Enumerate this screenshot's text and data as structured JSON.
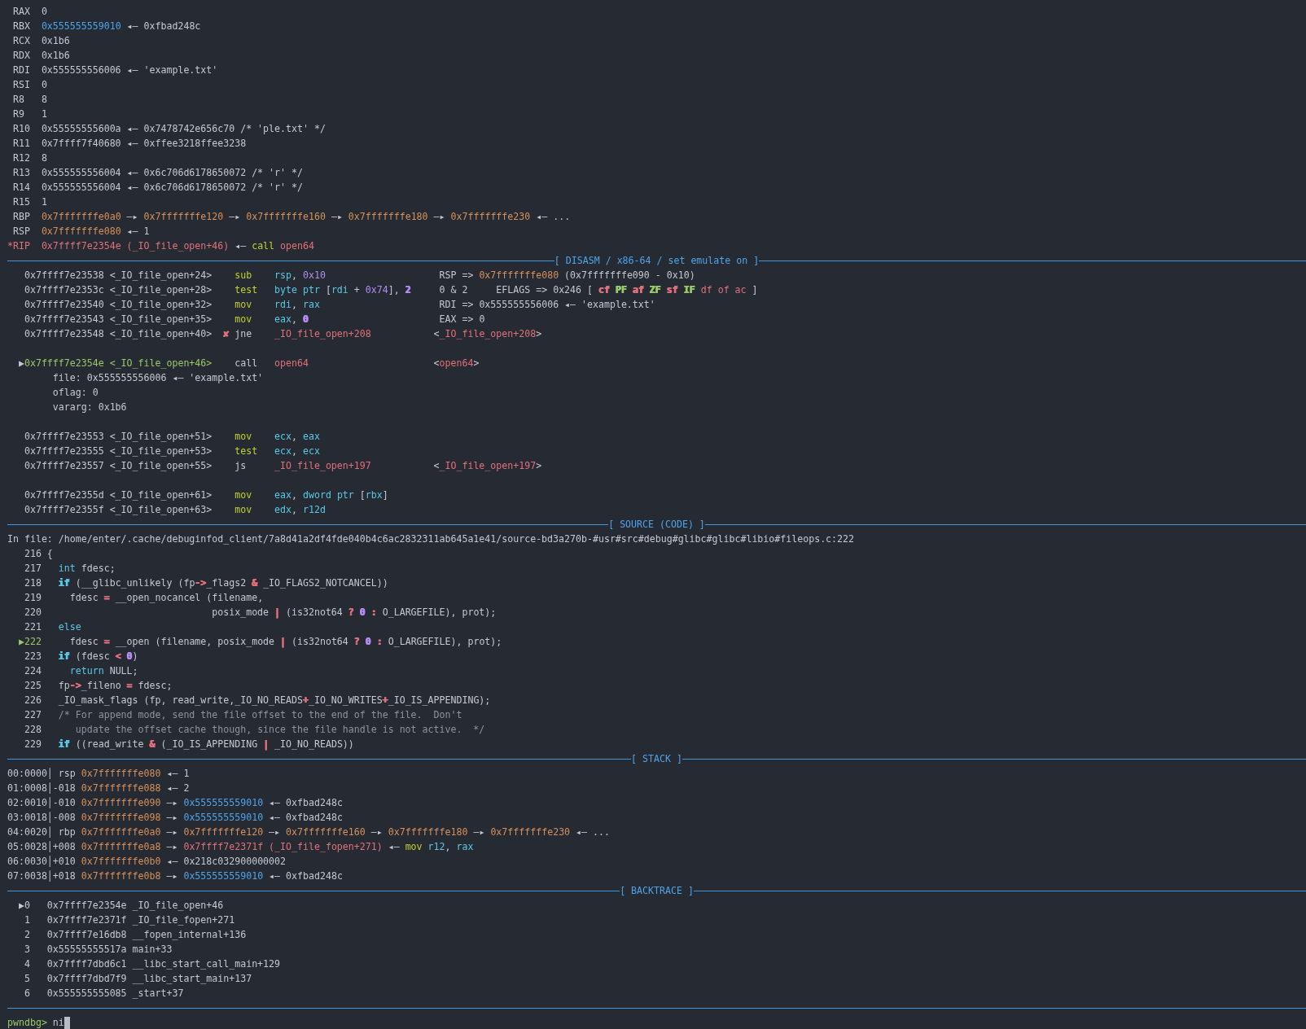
{
  "panels": [
    {
      "kind": "registers",
      "lines": [
        {
          "kind": "text",
          "spans": [
            {
              "t": " RAX  0"
            }
          ]
        },
        {
          "kind": "text",
          "spans": [
            {
              "t": " RBX  "
            },
            {
              "t": "0x555555559010",
              "color": "#4ea4ea"
            },
            {
              "t": " ◂— 0xfbad248c"
            }
          ]
        },
        {
          "kind": "text",
          "spans": [
            {
              "t": " RCX  0x1b6"
            }
          ]
        },
        {
          "kind": "text",
          "spans": [
            {
              "t": " RDX  0x1b6"
            }
          ]
        },
        {
          "kind": "text",
          "spans": [
            {
              "t": " RDI  0x555555556006 ◂— 'example.txt'"
            }
          ]
        },
        {
          "kind": "text",
          "spans": [
            {
              "t": " RSI  0"
            }
          ]
        },
        {
          "kind": "text",
          "spans": [
            {
              "t": " R8   8"
            }
          ]
        },
        {
          "kind": "text",
          "spans": [
            {
              "t": " R9   1"
            }
          ]
        },
        {
          "kind": "text",
          "spans": [
            {
              "t": " R10  0x55555555600a ◂— 0x7478742e656c70 /* 'ple.txt' */"
            }
          ]
        },
        {
          "kind": "text",
          "spans": [
            {
              "t": " R11  0x7ffff7f40680 ◂— 0xffee3218ffee3238"
            }
          ]
        },
        {
          "kind": "text",
          "spans": [
            {
              "t": " R12  8"
            }
          ]
        },
        {
          "kind": "text",
          "spans": [
            {
              "t": " R13  0x555555556004 ◂— 0x6c706d6178650072 /* 'r' */"
            }
          ]
        },
        {
          "kind": "text",
          "spans": [
            {
              "t": " R14  0x555555556004 ◂— 0x6c706d6178650072 /* 'r' */"
            }
          ]
        },
        {
          "kind": "text",
          "spans": [
            {
              "t": " R15  1"
            }
          ]
        },
        {
          "kind": "text",
          "spans": [
            {
              "t": " RBP  "
            },
            {
              "t": "0x7fffffffe0a0",
              "color": "#d6915a"
            },
            {
              "t": " —▸ "
            },
            {
              "t": "0x7fffffffe120",
              "color": "#d6915a"
            },
            {
              "t": " —▸ "
            },
            {
              "t": "0x7fffffffe160",
              "color": "#d6915a"
            },
            {
              "t": " —▸ "
            },
            {
              "t": "0x7fffffffe180",
              "color": "#d6915a"
            },
            {
              "t": " —▸ "
            },
            {
              "t": "0x7fffffffe230",
              "color": "#d6915a"
            },
            {
              "t": " ◂— ..."
            }
          ]
        },
        {
          "kind": "text",
          "spans": [
            {
              "t": " RSP  "
            },
            {
              "t": "0x7fffffffe080",
              "color": "#d6915a"
            },
            {
              "t": " ◂— 1"
            }
          ]
        },
        {
          "kind": "text",
          "spans": [
            {
              "t": "*RIP  ",
              "color": "#e0707a"
            },
            {
              "t": "0x7ffff7e2354e (_IO_file_open+46)",
              "color": "#e0707a"
            },
            {
              "t": " ◂— "
            },
            {
              "t": "call ",
              "color": "#bfd02c"
            },
            {
              "t": "open64",
              "color": "#e0707a"
            }
          ]
        }
      ]
    },
    {
      "kind": "disasm",
      "title": "[ DISASM / x86-64 / set emulate on ]",
      "lines": [
        {
          "kind": "text",
          "spans": [
            {
              "t": "   0x7ffff7e23538 <_IO_file_open+24>    "
            },
            {
              "t": "sub    ",
              "color": "#bfd02c"
            },
            {
              "t": "rsp",
              "color": "#59c8e6"
            },
            {
              "t": ", "
            },
            {
              "t": "0x10",
              "color": "#b38cf2"
            },
            {
              "t": "                    RSP => "
            },
            {
              "t": "0x7fffffffe080",
              "color": "#d6915a"
            },
            {
              "t": " (0x7fffffffe090 - 0x10)"
            }
          ]
        },
        {
          "kind": "text",
          "spans": [
            {
              "t": "   0x7ffff7e2353c <_IO_file_open+28>    "
            },
            {
              "t": "test   ",
              "color": "#bfd02c"
            },
            {
              "t": "byte ptr",
              "color": "#59c8e6"
            },
            {
              "t": " ["
            },
            {
              "t": "rdi",
              "color": "#59c8e6"
            },
            {
              "t": " + "
            },
            {
              "t": "0x74",
              "color": "#b38cf2"
            },
            {
              "t": "], "
            },
            {
              "t": "2",
              "color": "#b38cf2"
            },
            {
              "t": "     0 & 2     EFLAGS => 0x246 [ "
            },
            {
              "t": "cf ",
              "color": "#e0707a"
            },
            {
              "t": "PF ",
              "color": "#98c868"
            },
            {
              "t": "af ",
              "color": "#e0707a"
            },
            {
              "t": "ZF ",
              "color": "#98c868"
            },
            {
              "t": "sf ",
              "color": "#e0707a"
            },
            {
              "t": "IF ",
              "color": "#98c868"
            },
            {
              "t": "df of ac",
              "color": "#e0707a"
            },
            {
              "t": " ]"
            }
          ]
        },
        {
          "kind": "text",
          "spans": [
            {
              "t": "   0x7ffff7e23540 <_IO_file_open+32>    "
            },
            {
              "t": "mov    ",
              "color": "#bfd02c"
            },
            {
              "t": "rdi",
              "color": "#59c8e6"
            },
            {
              "t": ", "
            },
            {
              "t": "rax",
              "color": "#59c8e6"
            },
            {
              "t": "                     RDI => 0x555555556006 ◂— 'example.txt'"
            }
          ]
        },
        {
          "kind": "text",
          "spans": [
            {
              "t": "   0x7ffff7e23543 <_IO_file_open+35>    "
            },
            {
              "t": "mov    ",
              "color": "#bfd02c"
            },
            {
              "t": "eax",
              "color": "#59c8e6"
            },
            {
              "t": ", "
            },
            {
              "t": "0",
              "color": "#b38cf2"
            },
            {
              "t": "                       EAX => 0"
            }
          ]
        },
        {
          "kind": "text",
          "spans": [
            {
              "t": "   0x7ffff7e23548 <_IO_file_open+40>  "
            },
            {
              "t": "✘",
              "color": "#e0707a"
            },
            {
              "t": " jne    "
            },
            {
              "t": "_IO_file_open+208",
              "color": "#e0707a"
            },
            {
              "t": "           <"
            },
            {
              "t": "_IO_file_open+208",
              "color": "#e0707a"
            },
            {
              "t": ">"
            }
          ]
        },
        {
          "kind": "blank"
        },
        {
          "kind": "text",
          "spans": [
            {
              "t": "  ▶"
            },
            {
              "t": "0x7ffff7e2354e <_IO_file_open+46>",
              "color": "#98c868"
            },
            {
              "t": "    call   "
            },
            {
              "t": "open64",
              "color": "#e0707a"
            },
            {
              "t": "                      <"
            },
            {
              "t": "open64",
              "color": "#e0707a"
            },
            {
              "t": ">"
            }
          ]
        },
        {
          "kind": "text",
          "spans": [
            {
              "t": "        file: 0x555555556006 ◂— 'example.txt'"
            }
          ]
        },
        {
          "kind": "text",
          "spans": [
            {
              "t": "        oflag: 0"
            }
          ]
        },
        {
          "kind": "text",
          "spans": [
            {
              "t": "        vararg: 0x1b6"
            }
          ]
        },
        {
          "kind": "blank"
        },
        {
          "kind": "text",
          "spans": [
            {
              "t": "   0x7ffff7e23553 <_IO_file_open+51>    "
            },
            {
              "t": "mov    ",
              "color": "#bfd02c"
            },
            {
              "t": "ecx",
              "color": "#59c8e6"
            },
            {
              "t": ", "
            },
            {
              "t": "eax",
              "color": "#59c8e6"
            }
          ]
        },
        {
          "kind": "text",
          "spans": [
            {
              "t": "   0x7ffff7e23555 <_IO_file_open+53>    "
            },
            {
              "t": "test   ",
              "color": "#bfd02c"
            },
            {
              "t": "ecx",
              "color": "#59c8e6"
            },
            {
              "t": ", "
            },
            {
              "t": "ecx",
              "color": "#59c8e6"
            }
          ]
        },
        {
          "kind": "text",
          "spans": [
            {
              "t": "   0x7ffff7e23557 <_IO_file_open+55>    js     "
            },
            {
              "t": "_IO_file_open+197",
              "color": "#e0707a"
            },
            {
              "t": "           <"
            },
            {
              "t": "_IO_file_open+197",
              "color": "#e0707a"
            },
            {
              "t": ">"
            }
          ]
        },
        {
          "kind": "blank"
        },
        {
          "kind": "text",
          "spans": [
            {
              "t": "   0x7ffff7e2355d <_IO_file_open+61>    "
            },
            {
              "t": "mov    ",
              "color": "#bfd02c"
            },
            {
              "t": "eax",
              "color": "#59c8e6"
            },
            {
              "t": ", "
            },
            {
              "t": "dword ptr",
              "color": "#59c8e6"
            },
            {
              "t": " ["
            },
            {
              "t": "rbx",
              "color": "#59c8e6"
            },
            {
              "t": "]"
            }
          ]
        },
        {
          "kind": "text",
          "spans": [
            {
              "t": "   0x7ffff7e2355f <_IO_file_open+63>    "
            },
            {
              "t": "mov    ",
              "color": "#bfd02c"
            },
            {
              "t": "edx",
              "color": "#59c8e6"
            },
            {
              "t": ", "
            },
            {
              "t": "r12d",
              "color": "#59c8e6"
            }
          ]
        }
      ]
    },
    {
      "kind": "source",
      "title": "[ SOURCE (CODE) ]",
      "lines": [
        {
          "kind": "path",
          "spans": [
            {
              "t": "In file: /home/enter/.cache/debuginfod_client/7a8d41a2df4fde040b4c6ac2832311ab645a1e41/source-bd3a270b-#usr#src#debug#glibc#glibc#libio#fileops.c:222"
            }
          ]
        },
        {
          "kind": "text",
          "spans": [
            {
              "t": "   216 {"
            }
          ]
        },
        {
          "kind": "text",
          "spans": [
            {
              "t": "   217   "
            },
            {
              "t": "int",
              "color": "#59c8e6"
            },
            {
              "t": " fdesc;"
            }
          ]
        },
        {
          "kind": "text",
          "spans": [
            {
              "t": "   218   "
            },
            {
              "t": "if",
              "color": "#59c8e6"
            },
            {
              "t": " (__glibc_unlikely (fp"
            },
            {
              "t": "->",
              "color": "#e0707a"
            },
            {
              "t": "_flags2 "
            },
            {
              "t": "&",
              "color": "#e0707a"
            },
            {
              "t": " _IO_FLAGS2_NOTCANCEL))"
            }
          ]
        },
        {
          "kind": "text",
          "spans": [
            {
              "t": "   219     fdesc "
            },
            {
              "t": "=",
              "color": "#e0707a"
            },
            {
              "t": " __open_nocancel (filename,"
            }
          ]
        },
        {
          "kind": "text",
          "spans": [
            {
              "t": "   220                              posix_mode "
            },
            {
              "t": "|",
              "color": "#e0707a"
            },
            {
              "t": " (is32not64 "
            },
            {
              "t": "? ",
              "color": "#e0707a"
            },
            {
              "t": "0 ",
              "color": "#b38cf2"
            },
            {
              "t": ":",
              "color": "#e0707a"
            },
            {
              "t": " O_LARGEFILE), prot);"
            }
          ]
        },
        {
          "kind": "text",
          "spans": [
            {
              "t": "   221   "
            },
            {
              "t": "else",
              "color": "#59c8e6"
            }
          ]
        },
        {
          "kind": "text",
          "spans": [
            {
              "t": "  ▶222",
              "color": "#98c868"
            },
            {
              "t": "     fdesc "
            },
            {
              "t": "=",
              "color": "#e0707a"
            },
            {
              "t": " __open (filename, posix_mode "
            },
            {
              "t": "|",
              "color": "#e0707a"
            },
            {
              "t": " (is32not64 "
            },
            {
              "t": "? ",
              "color": "#e0707a"
            },
            {
              "t": "0 ",
              "color": "#b38cf2"
            },
            {
              "t": ":",
              "color": "#e0707a"
            },
            {
              "t": " O_LARGEFILE), prot);"
            }
          ]
        },
        {
          "kind": "text",
          "spans": [
            {
              "t": "   223   "
            },
            {
              "t": "if",
              "color": "#59c8e6"
            },
            {
              "t": " (fdesc "
            },
            {
              "t": "< ",
              "color": "#e0707a"
            },
            {
              "t": "0",
              "color": "#b38cf2"
            },
            {
              "t": ")"
            }
          ]
        },
        {
          "kind": "text",
          "spans": [
            {
              "t": "   224     "
            },
            {
              "t": "return",
              "color": "#59c8e6"
            },
            {
              "t": " NULL;"
            }
          ]
        },
        {
          "kind": "text",
          "spans": [
            {
              "t": "   225   fp"
            },
            {
              "t": "->",
              "color": "#e0707a"
            },
            {
              "t": "_fileno "
            },
            {
              "t": "=",
              "color": "#e0707a"
            },
            {
              "t": " fdesc;"
            }
          ]
        },
        {
          "kind": "text",
          "spans": [
            {
              "t": "   226   _IO_mask_flags (fp, read_write,_IO_NO_READS"
            },
            {
              "t": "+",
              "color": "#e0707a"
            },
            {
              "t": "_IO_NO_WRITES"
            },
            {
              "t": "+",
              "color": "#e0707a"
            },
            {
              "t": "_IO_IS_APPENDING);"
            }
          ]
        },
        {
          "kind": "text",
          "spans": [
            {
              "t": "   227   "
            },
            {
              "t": "/* For append mode, send the file offset to the end of the file.  Don't",
              "color": "#8d929b"
            }
          ]
        },
        {
          "kind": "text",
          "spans": [
            {
              "t": "   228   "
            },
            {
              "t": "   update the offset cache though, since the file handle is not active.  */",
              "color": "#8d929b"
            }
          ]
        },
        {
          "kind": "text",
          "spans": [
            {
              "t": "   229   "
            },
            {
              "t": "if",
              "color": "#59c8e6"
            },
            {
              "t": " ((read_write "
            },
            {
              "t": "&",
              "color": "#e0707a"
            },
            {
              "t": " (_IO_IS_APPENDING "
            },
            {
              "t": "|",
              "color": "#e0707a"
            },
            {
              "t": " _IO_NO_READS))"
            }
          ]
        }
      ]
    },
    {
      "kind": "stack",
      "title": "[ STACK ]",
      "lines": [
        {
          "kind": "text",
          "spans": [
            {
              "t": "00:0000│ rsp "
            },
            {
              "t": "0x7fffffffe080",
              "color": "#d6915a"
            },
            {
              "t": " ◂— 1"
            }
          ]
        },
        {
          "kind": "text",
          "spans": [
            {
              "t": "01:0008│-018 "
            },
            {
              "t": "0x7fffffffe088",
              "color": "#d6915a"
            },
            {
              "t": " ◂— 2"
            }
          ]
        },
        {
          "kind": "text",
          "spans": [
            {
              "t": "02:0010│-010 "
            },
            {
              "t": "0x7fffffffe090",
              "color": "#d6915a"
            },
            {
              "t": " —▸ "
            },
            {
              "t": "0x555555559010",
              "color": "#4ea4ea"
            },
            {
              "t": " ◂— 0xfbad248c"
            }
          ]
        },
        {
          "kind": "text",
          "spans": [
            {
              "t": "03:0018│-008 "
            },
            {
              "t": "0x7fffffffe098",
              "color": "#d6915a"
            },
            {
              "t": " —▸ "
            },
            {
              "t": "0x555555559010",
              "color": "#4ea4ea"
            },
            {
              "t": " ◂— 0xfbad248c"
            }
          ]
        },
        {
          "kind": "text",
          "spans": [
            {
              "t": "04:0020│ rbp "
            },
            {
              "t": "0x7fffffffe0a0",
              "color": "#d6915a"
            },
            {
              "t": " —▸ "
            },
            {
              "t": "0x7fffffffe120",
              "color": "#d6915a"
            },
            {
              "t": " —▸ "
            },
            {
              "t": "0x7fffffffe160",
              "color": "#d6915a"
            },
            {
              "t": " —▸ "
            },
            {
              "t": "0x7fffffffe180",
              "color": "#d6915a"
            },
            {
              "t": " —▸ "
            },
            {
              "t": "0x7fffffffe230",
              "color": "#d6915a"
            },
            {
              "t": " ◂— ..."
            }
          ]
        },
        {
          "kind": "text",
          "spans": [
            {
              "t": "05:0028│+008 "
            },
            {
              "t": "0x7fffffffe0a8",
              "color": "#d6915a"
            },
            {
              "t": " —▸ "
            },
            {
              "t": "0x7ffff7e2371f (_IO_file_fopen+271)",
              "color": "#e0707a"
            },
            {
              "t": " ◂— "
            },
            {
              "t": "mov ",
              "color": "#bfd02c"
            },
            {
              "t": "r12",
              "color": "#59c8e6"
            },
            {
              "t": ", "
            },
            {
              "t": "rax",
              "color": "#59c8e6"
            }
          ]
        },
        {
          "kind": "text",
          "spans": [
            {
              "t": "06:0030│+010 "
            },
            {
              "t": "0x7fffffffe0b0",
              "color": "#d6915a"
            },
            {
              "t": " ◂— 0x218c032900000002"
            }
          ]
        },
        {
          "kind": "text",
          "spans": [
            {
              "t": "07:0038│+018 "
            },
            {
              "t": "0x7fffffffe0b8",
              "color": "#d6915a"
            },
            {
              "t": " —▸ "
            },
            {
              "t": "0x555555559010",
              "color": "#4ea4ea"
            },
            {
              "t": " ◂— 0xfbad248c"
            }
          ]
        }
      ]
    },
    {
      "kind": "backtrace",
      "title": "[ BACKTRACE ]",
      "lines": [
        {
          "kind": "text",
          "spans": [
            {
              "t": "  ▶0   0x7ffff7e2354e _IO_file_open+46"
            }
          ]
        },
        {
          "kind": "text",
          "spans": [
            {
              "t": "   1   0x7ffff7e2371f _IO_file_fopen+271"
            }
          ]
        },
        {
          "kind": "text",
          "spans": [
            {
              "t": "   2   0x7ffff7e16db8 __fopen_internal+136"
            }
          ]
        },
        {
          "kind": "text",
          "spans": [
            {
              "t": "   3   0x55555555517a main+33"
            }
          ]
        },
        {
          "kind": "text",
          "spans": [
            {
              "t": "   4   0x7ffff7dbd6c1 __libc_start_call_main+129"
            }
          ]
        },
        {
          "kind": "text",
          "spans": [
            {
              "t": "   5   0x7ffff7dbd7f9 __libc_start_main+137"
            }
          ]
        },
        {
          "kind": "text",
          "spans": [
            {
              "t": "   6   0x555555555085 _start+37"
            }
          ]
        }
      ]
    }
  ],
  "prompt": {
    "label": "pwndbg> ",
    "value": "ni"
  }
}
